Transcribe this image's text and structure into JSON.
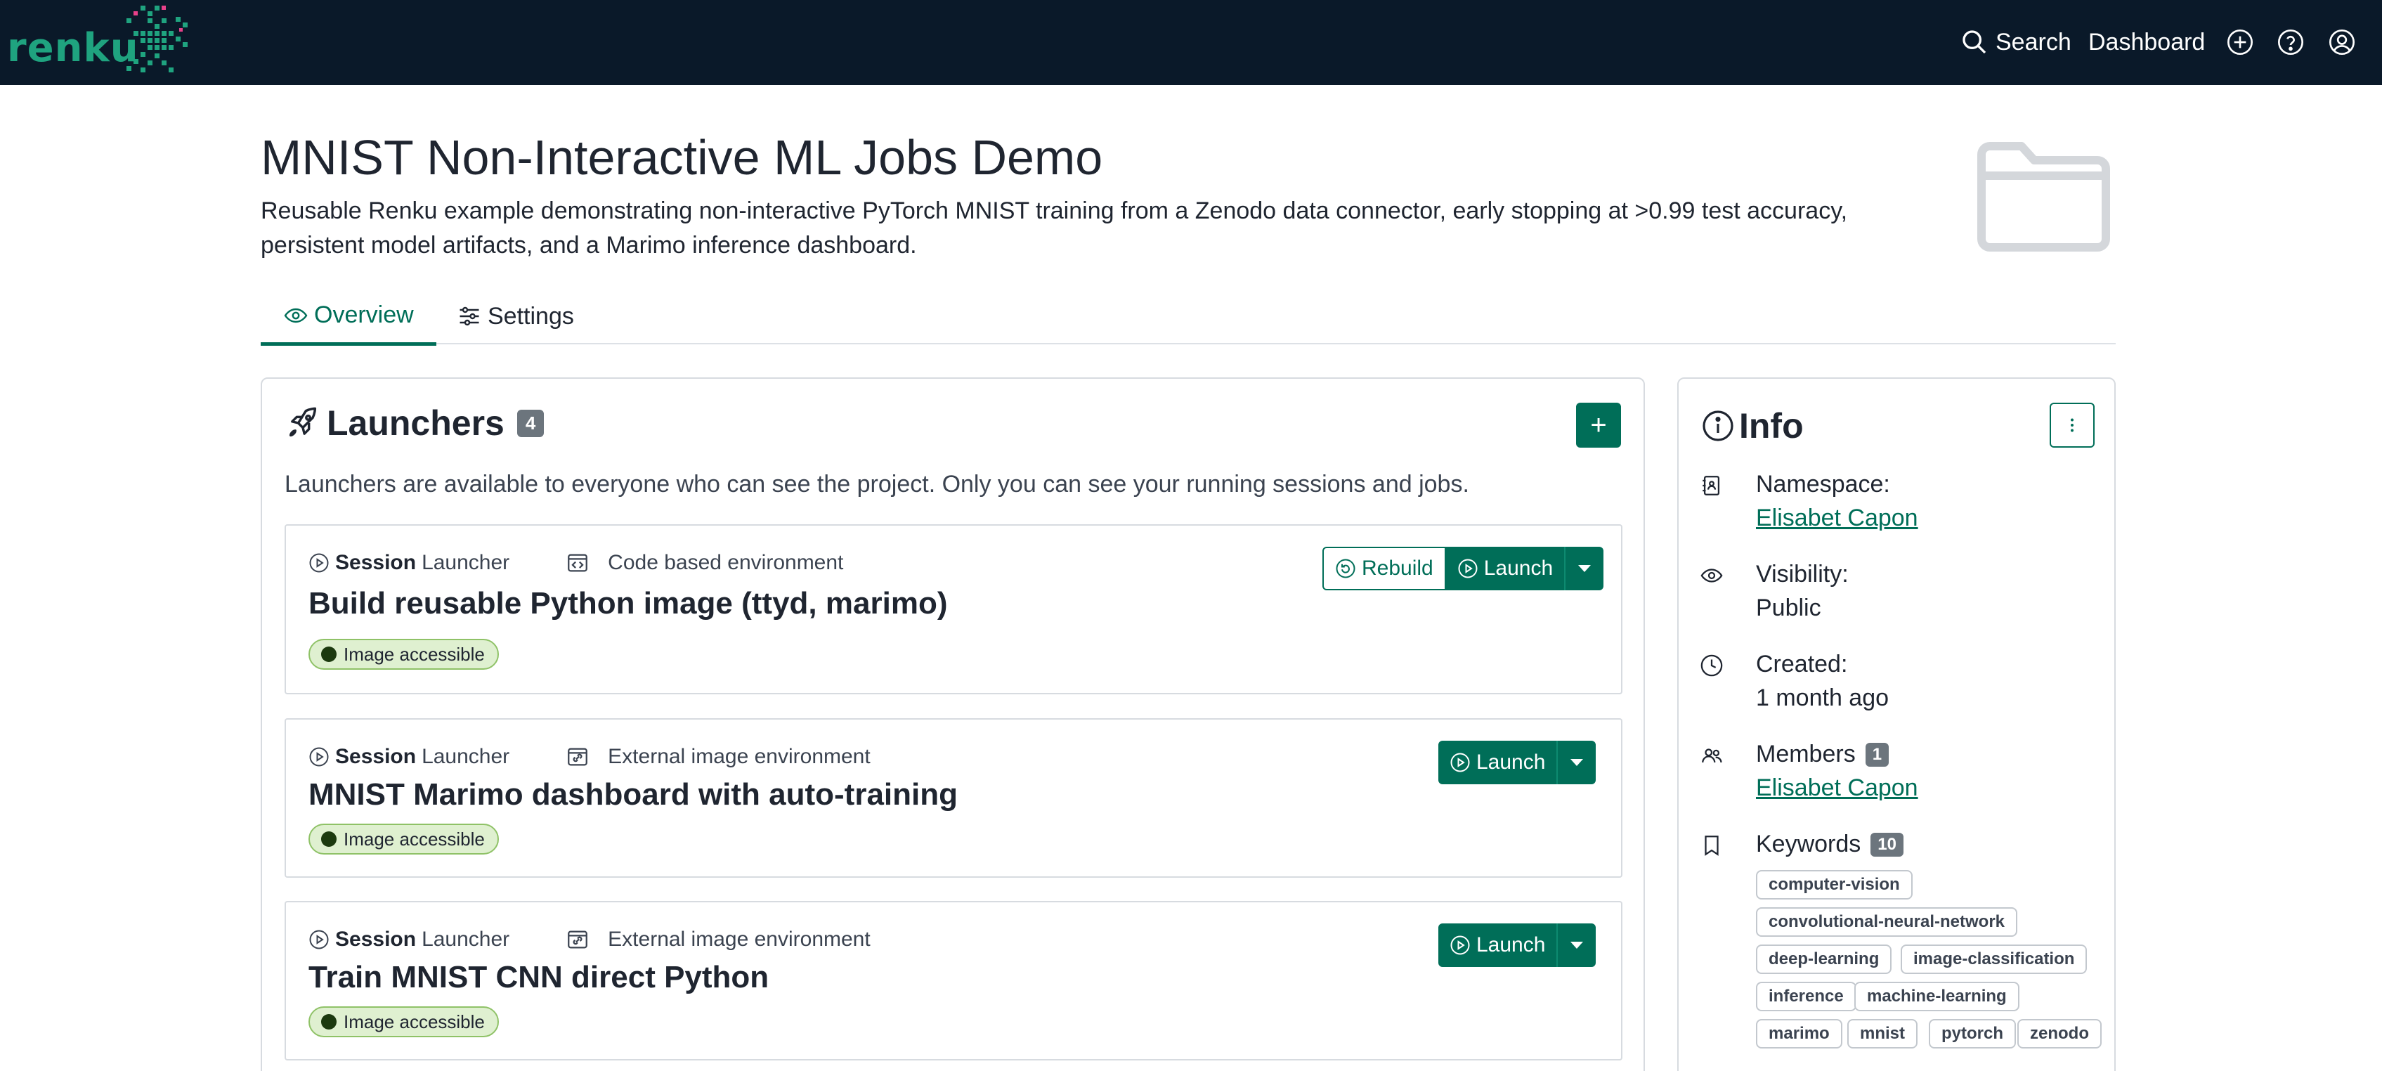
{
  "nav": {
    "logo_text": "renku",
    "search_label": "Search",
    "dashboard_label": "Dashboard"
  },
  "project": {
    "title": "MNIST Non-Interactive ML Jobs Demo",
    "description": "Reusable Renku example demonstrating non-interactive PyTorch MNIST training from a Zenodo data connector, early stopping at >0.99 test accuracy, persistent model artifacts, and a Marimo inference dashboard."
  },
  "tabs": [
    {
      "label": "Overview",
      "active": true
    },
    {
      "label": "Settings",
      "active": false
    }
  ],
  "launchers": {
    "title": "Launchers",
    "count": "4",
    "add_label": "+",
    "note": "Launchers are available to everyone who can see the project. Only you can see your running sessions and jobs.",
    "items": [
      {
        "kind_bold": "Session",
        "kind_rest": "Launcher",
        "environment": "Code based environment",
        "name": "Build reusable Python image (ttyd, marimo)",
        "status": "Image accessible",
        "rebuild_label": "Rebuild",
        "launch_label": "Launch"
      },
      {
        "kind_bold": "Session",
        "kind_rest": "Launcher",
        "environment": "External image environment",
        "name": "MNIST Marimo dashboard with auto-training",
        "status": "Image accessible",
        "launch_label": "Launch"
      },
      {
        "kind_bold": "Session",
        "kind_rest": "Launcher",
        "environment": "External image environment",
        "name": "Train MNIST CNN direct Python",
        "status": "Image accessible",
        "launch_label": "Launch"
      }
    ]
  },
  "info": {
    "title": "Info",
    "namespace_label": "Namespace:",
    "namespace_value": "Elisabet Capon",
    "visibility_label": "Visibility:",
    "visibility_value": "Public",
    "created_label": "Created:",
    "created_value": "1 month ago",
    "members_label": "Members",
    "members_count": "1",
    "member_name": "Elisabet Capon",
    "keywords_label": "Keywords",
    "keywords_count": "10",
    "keywords": [
      "computer-vision",
      "convolutional-neural-network",
      "deep-learning",
      "image-classification",
      "inference",
      "machine-learning",
      "marimo",
      "mnist",
      "pytorch",
      "zenodo"
    ]
  },
  "colors": {
    "navbar": "#0a1929",
    "brand": "#1fa37f",
    "primary": "#006e58",
    "badge_bg": "#dff0d0"
  }
}
